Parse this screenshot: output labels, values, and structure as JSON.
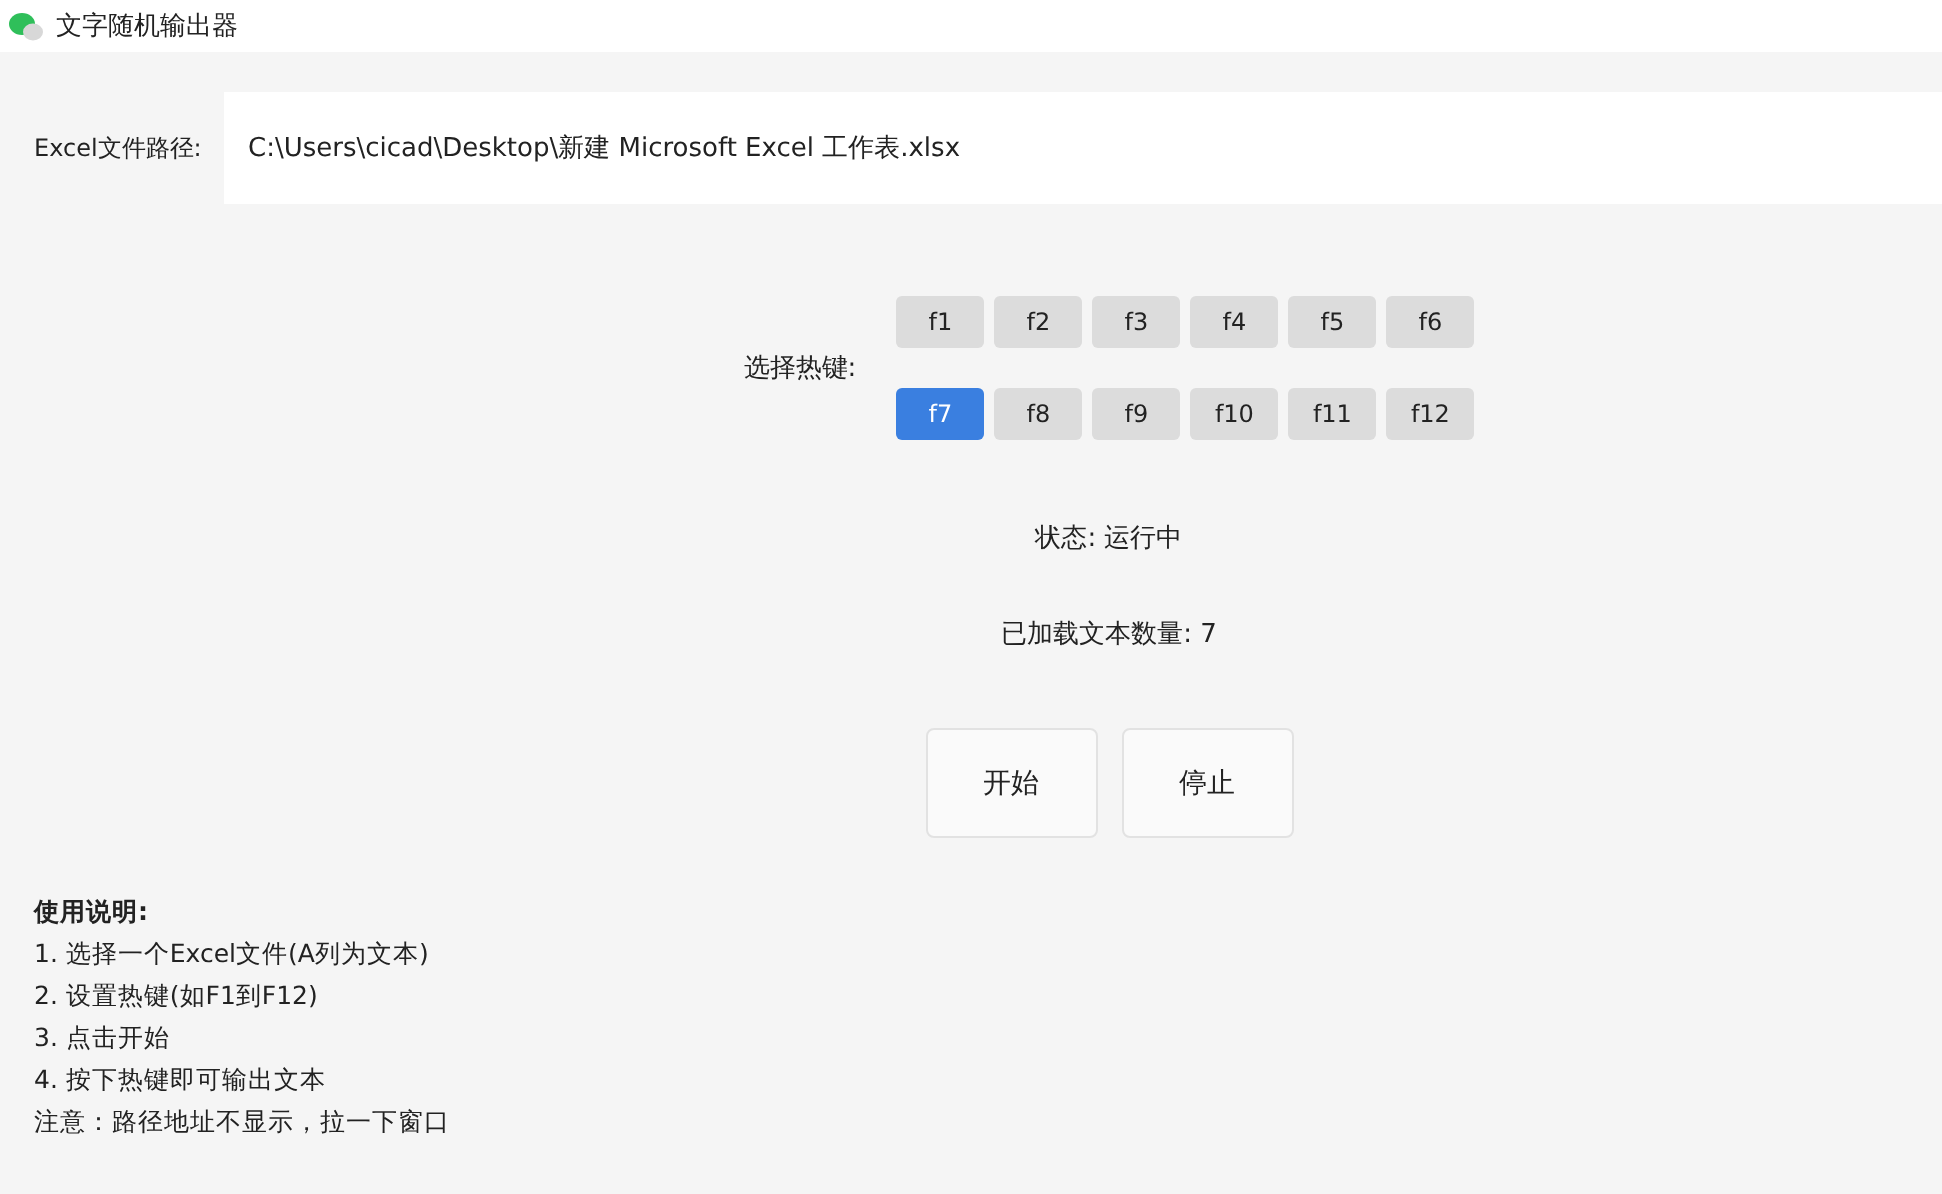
{
  "window": {
    "title": "文字随机输出器"
  },
  "path": {
    "label": "Excel文件路径:",
    "value": "C:\\Users\\cicad\\Desktop\\新建 Microsoft Excel 工作表.xlsx"
  },
  "hotkeys": {
    "label": "选择热键:",
    "keys": [
      {
        "label": "f1",
        "selected": false
      },
      {
        "label": "f2",
        "selected": false
      },
      {
        "label": "f3",
        "selected": false
      },
      {
        "label": "f4",
        "selected": false
      },
      {
        "label": "f5",
        "selected": false
      },
      {
        "label": "f6",
        "selected": false
      },
      {
        "label": "f7",
        "selected": true
      },
      {
        "label": "f8",
        "selected": false
      },
      {
        "label": "f9",
        "selected": false
      },
      {
        "label": "f10",
        "selected": false
      },
      {
        "label": "f11",
        "selected": false
      },
      {
        "label": "f12",
        "selected": false
      }
    ]
  },
  "status": "状态: 运行中",
  "loaded_count": "已加载文本数量: 7",
  "buttons": [
    "开始",
    "停止"
  ],
  "instructions": {
    "title": "使用说明:",
    "lines": [
      "1. 选择一个Excel文件(A列为文本)",
      "2. 设置热键(如F1到F12)",
      "3. 点击开始",
      "4. 按下热键即可输出文本",
      "注意：路径地址不显示，拉一下窗口"
    ]
  }
}
